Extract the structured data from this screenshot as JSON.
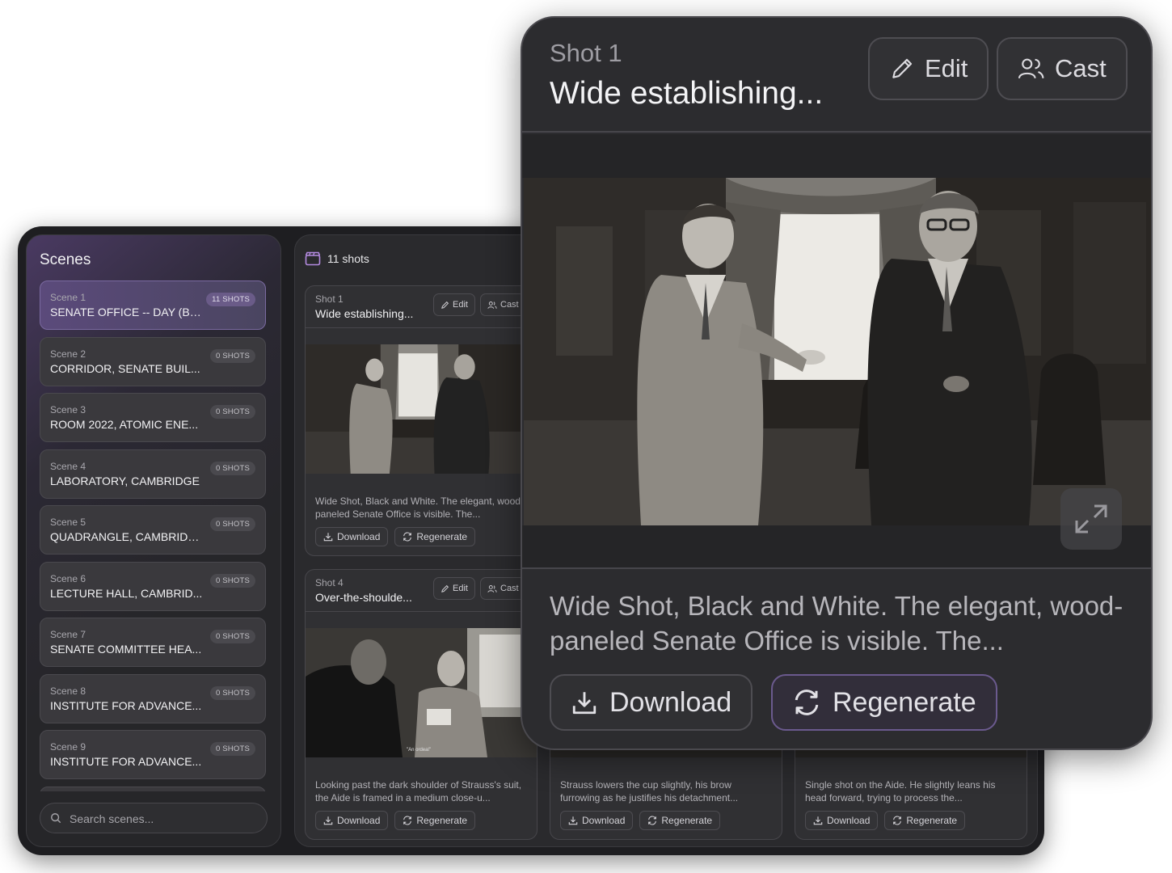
{
  "scenes": {
    "title": "Scenes",
    "items": [
      {
        "number": "Scene 1",
        "name": "SENATE OFFICE -- DAY (BL...",
        "shots": "11 SHOTS"
      },
      {
        "number": "Scene 2",
        "name": "CORRIDOR, SENATE BUIL...",
        "shots": "0 SHOTS"
      },
      {
        "number": "Scene 3",
        "name": "ROOM 2022, ATOMIC ENE...",
        "shots": "0 SHOTS"
      },
      {
        "number": "Scene 4",
        "name": "LABORATORY, CAMBRIDGE",
        "shots": "0 SHOTS"
      },
      {
        "number": "Scene 5",
        "name": "QUADRANGLE, CAMBRIDGE",
        "shots": "0 SHOTS"
      },
      {
        "number": "Scene 6",
        "name": "LECTURE HALL, CAMBRID...",
        "shots": "0 SHOTS"
      },
      {
        "number": "Scene 7",
        "name": "SENATE COMMITTEE HEA...",
        "shots": "0 SHOTS"
      },
      {
        "number": "Scene 8",
        "name": "INSTITUTE FOR ADVANCE...",
        "shots": "0 SHOTS"
      },
      {
        "number": "Scene 9",
        "name": "INSTITUTE FOR ADVANCE...",
        "shots": "0 SHOTS"
      },
      {
        "number": "",
        "name": "",
        "shots": ""
      }
    ],
    "search_placeholder": "Search scenes..."
  },
  "shots": {
    "count_label": "11 shots",
    "edit_label": "Edit",
    "cast_label": "Cast",
    "download_label": "Download",
    "regenerate_label": "Regenerate",
    "cards": [
      {
        "label": "Shot 1",
        "title": "Wide establishing...",
        "desc": "Wide Shot, Black and White. The elegant, wood-paneled Senate Office is visible. The..."
      },
      {
        "label": "Shot 4",
        "title": "Over-the-shoulde...",
        "desc": "Looking past the dark shoulder of Strauss's suit, the Aide is framed in a medium close-u...",
        "caption": "\"An ordeal\""
      },
      {
        "label": "",
        "title": "",
        "desc": "Strauss lowers the cup slightly, his brow furrowing as he justifies his detachment..."
      },
      {
        "label": "",
        "title": "",
        "desc": "Single shot on the Aide. He slightly leans his head forward, trying to process the..."
      }
    ]
  },
  "zoom": {
    "label": "Shot 1",
    "title": "Wide establishing...",
    "edit_label": "Edit",
    "cast_label": "Cast",
    "desc": "Wide Shot, Black and White. The elegant, wood-paneled Senate Office is visible. The...",
    "download_label": "Download",
    "regenerate_label": "Regenerate"
  },
  "colors": {
    "accent": "#6b5a8e",
    "panel": "#2a2a2d",
    "app_bg": "#1e1e21"
  }
}
